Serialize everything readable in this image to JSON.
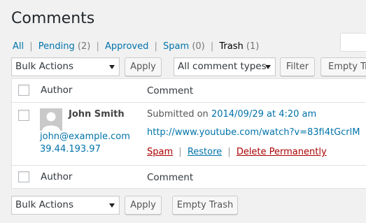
{
  "page": {
    "title": "Comments"
  },
  "filters": {
    "all": "All",
    "pending": "Pending",
    "pending_count": "(2)",
    "approved": "Approved",
    "spam": "Spam",
    "spam_count": "(0)",
    "trash": "Trash",
    "trash_count": "(1)",
    "separator": "|"
  },
  "toolbar_top": {
    "bulk_actions": "Bulk Actions",
    "apply": "Apply",
    "comment_types": "All comment types",
    "filter": "Filter",
    "empty_trash": "Empty Trash"
  },
  "table": {
    "header_author": "Author",
    "header_comment": "Comment",
    "rows": [
      {
        "author_name": "John Smith",
        "author_email": "john@example.com",
        "author_ip": "39.44.193.97",
        "submitted_label": "Submitted on",
        "submitted_date": "2014/09/29 at 4:20 am",
        "comment_text": "http://www.youtube.com/watch?v=83fi4tGcrlM",
        "actions": {
          "spam": "Spam",
          "restore": "Restore",
          "delete": "Delete Permanently",
          "separator": "|"
        }
      }
    ]
  },
  "toolbar_bottom": {
    "bulk_actions": "Bulk Actions",
    "apply": "Apply",
    "empty_trash": "Empty Trash"
  },
  "colors": {
    "link": "#0073aa",
    "danger": "#aa0000",
    "background": "#f1f1f1"
  },
  "icons": {
    "avatar": "default-avatar-icon",
    "dropdown": "chevron-down-icon"
  }
}
